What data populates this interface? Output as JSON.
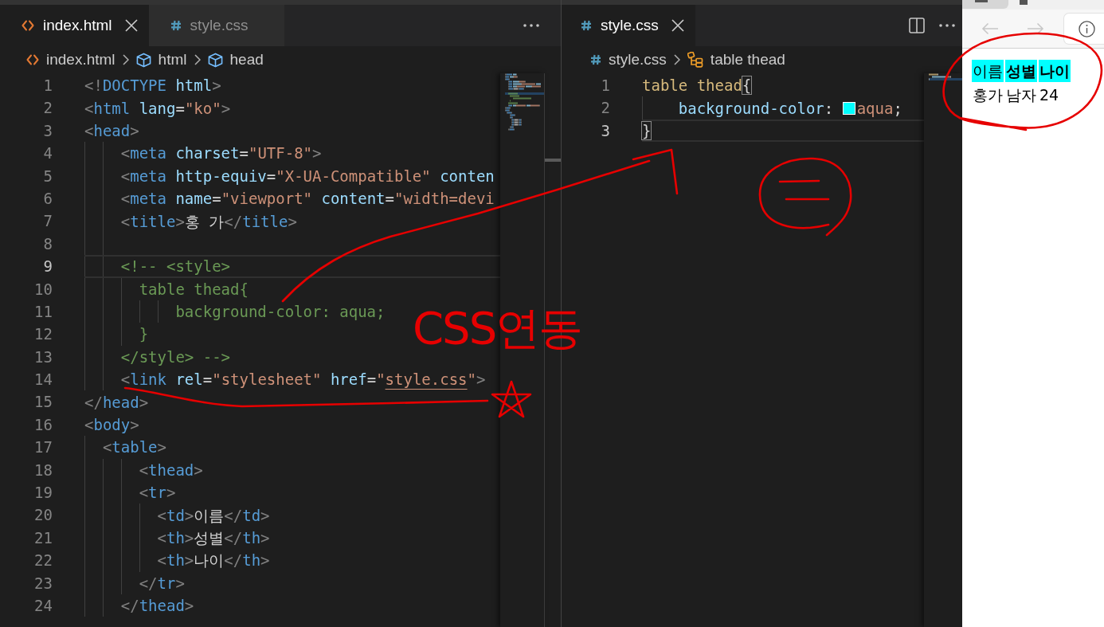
{
  "left_editor": {
    "tabs": [
      {
        "label": "index.html",
        "kind": "html",
        "selected": true
      },
      {
        "label": "style.css",
        "kind": "css",
        "selected": false
      }
    ],
    "breadcrumb": [
      {
        "label": "index.html",
        "kind": "html"
      },
      {
        "label": "html",
        "kind": "element"
      },
      {
        "label": "head",
        "kind": "element"
      }
    ],
    "lines": [
      {
        "number": "1",
        "current": false,
        "tokens": [
          {
            "kind": "punct",
            "text": "<!"
          },
          {
            "kind": "tag",
            "text": "DOCTYPE"
          },
          {
            "kind": "attr",
            "text": " html"
          },
          {
            "kind": "punct",
            "text": ">"
          }
        ]
      },
      {
        "number": "2",
        "current": false,
        "tokens": [
          {
            "kind": "punct",
            "text": "<"
          },
          {
            "kind": "tag",
            "text": "html"
          },
          {
            "kind": "attr",
            "text": " lang"
          },
          {
            "kind": "plain",
            "text": "="
          },
          {
            "kind": "string",
            "text": "\"ko\""
          },
          {
            "kind": "punct",
            "text": ">"
          }
        ]
      },
      {
        "number": "3",
        "current": false,
        "tokens": [
          {
            "kind": "punct",
            "text": "<"
          },
          {
            "kind": "tag",
            "text": "head"
          },
          {
            "kind": "punct",
            "text": ">"
          }
        ]
      },
      {
        "number": "4",
        "current": false,
        "tokens": [
          {
            "kind": "punct",
            "text": "    <"
          },
          {
            "kind": "tag",
            "text": "meta"
          },
          {
            "kind": "attr",
            "text": " charset"
          },
          {
            "kind": "plain",
            "text": "="
          },
          {
            "kind": "string",
            "text": "\"UTF-8\""
          },
          {
            "kind": "punct",
            "text": ">"
          }
        ]
      },
      {
        "number": "5",
        "current": false,
        "tokens": [
          {
            "kind": "punct",
            "text": "    <"
          },
          {
            "kind": "tag",
            "text": "meta"
          },
          {
            "kind": "attr",
            "text": " http-equiv"
          },
          {
            "kind": "plain",
            "text": "="
          },
          {
            "kind": "string",
            "text": "\"X-UA-Compatible\""
          },
          {
            "kind": "attr",
            "text": " conten"
          }
        ]
      },
      {
        "number": "6",
        "current": false,
        "tokens": [
          {
            "kind": "punct",
            "text": "    <"
          },
          {
            "kind": "tag",
            "text": "meta"
          },
          {
            "kind": "attr",
            "text": " name"
          },
          {
            "kind": "plain",
            "text": "="
          },
          {
            "kind": "string",
            "text": "\"viewport\""
          },
          {
            "kind": "attr",
            "text": " content"
          },
          {
            "kind": "plain",
            "text": "="
          },
          {
            "kind": "string",
            "text": "\"width=devi"
          }
        ]
      },
      {
        "number": "7",
        "current": false,
        "tokens": [
          {
            "kind": "punct",
            "text": "    <"
          },
          {
            "kind": "tag",
            "text": "title"
          },
          {
            "kind": "punct",
            "text": ">"
          },
          {
            "kind": "plain",
            "text": "홍 가"
          },
          {
            "kind": "punct",
            "text": "</"
          },
          {
            "kind": "tag",
            "text": "title"
          },
          {
            "kind": "punct",
            "text": ">"
          }
        ]
      },
      {
        "number": "8",
        "current": false
      },
      {
        "number": "9",
        "current": true,
        "tokens": [
          {
            "kind": "comment",
            "text": "    <!-- <style>"
          }
        ]
      },
      {
        "number": "10",
        "current": false,
        "tokens": [
          {
            "kind": "comment",
            "text": "      table thead{"
          }
        ]
      },
      {
        "number": "11",
        "current": false,
        "tokens": [
          {
            "kind": "comment",
            "text": "          background-color: aqua;"
          }
        ]
      },
      {
        "number": "12",
        "current": false,
        "tokens": [
          {
            "kind": "comment",
            "text": "      }"
          }
        ]
      },
      {
        "number": "13",
        "current": false,
        "tokens": [
          {
            "kind": "comment",
            "text": "    </style> -->"
          }
        ]
      },
      {
        "number": "14",
        "current": false,
        "tokens": [
          {
            "kind": "punct",
            "text": "    <"
          },
          {
            "kind": "tag",
            "text": "link"
          },
          {
            "kind": "attr",
            "text": " rel"
          },
          {
            "kind": "plain",
            "text": "="
          },
          {
            "kind": "string",
            "text": "\"stylesheet\""
          },
          {
            "kind": "attr",
            "text": " href"
          },
          {
            "kind": "plain",
            "text": "="
          },
          {
            "kind": "string",
            "text": "\""
          },
          {
            "kind": "link",
            "text": "style.css"
          },
          {
            "kind": "string",
            "text": "\""
          },
          {
            "kind": "punct",
            "text": ">"
          }
        ]
      },
      {
        "number": "15",
        "current": false,
        "tokens": [
          {
            "kind": "punct",
            "text": "</"
          },
          {
            "kind": "tag",
            "text": "head"
          },
          {
            "kind": "punct",
            "text": ">"
          }
        ]
      },
      {
        "number": "16",
        "current": false,
        "tokens": [
          {
            "kind": "punct",
            "text": "<"
          },
          {
            "kind": "tag",
            "text": "body"
          },
          {
            "kind": "punct",
            "text": ">"
          }
        ]
      },
      {
        "number": "17",
        "current": false,
        "tokens": [
          {
            "kind": "punct",
            "text": "  <"
          },
          {
            "kind": "tag",
            "text": "table"
          },
          {
            "kind": "punct",
            "text": ">"
          }
        ]
      },
      {
        "number": "18",
        "current": false,
        "tokens": [
          {
            "kind": "punct",
            "text": "      <"
          },
          {
            "kind": "tag",
            "text": "thead"
          },
          {
            "kind": "punct",
            "text": ">"
          }
        ]
      },
      {
        "number": "19",
        "current": false,
        "tokens": [
          {
            "kind": "punct",
            "text": "      <"
          },
          {
            "kind": "tag",
            "text": "tr"
          },
          {
            "kind": "punct",
            "text": ">"
          }
        ]
      },
      {
        "number": "20",
        "current": false,
        "tokens": [
          {
            "kind": "punct",
            "text": "        <"
          },
          {
            "kind": "tag",
            "text": "td"
          },
          {
            "kind": "punct",
            "text": ">"
          },
          {
            "kind": "plain",
            "text": "이름"
          },
          {
            "kind": "punct",
            "text": "</"
          },
          {
            "kind": "tag",
            "text": "td"
          },
          {
            "kind": "punct",
            "text": ">"
          }
        ]
      },
      {
        "number": "21",
        "current": false,
        "tokens": [
          {
            "kind": "punct",
            "text": "        <"
          },
          {
            "kind": "tag",
            "text": "th"
          },
          {
            "kind": "punct",
            "text": ">"
          },
          {
            "kind": "plain",
            "text": "성별"
          },
          {
            "kind": "punct",
            "text": "</"
          },
          {
            "kind": "tag",
            "text": "th"
          },
          {
            "kind": "punct",
            "text": ">"
          }
        ]
      },
      {
        "number": "22",
        "current": false,
        "tokens": [
          {
            "kind": "punct",
            "text": "        <"
          },
          {
            "kind": "tag",
            "text": "th"
          },
          {
            "kind": "punct",
            "text": ">"
          },
          {
            "kind": "plain",
            "text": "나이"
          },
          {
            "kind": "punct",
            "text": "</"
          },
          {
            "kind": "tag",
            "text": "th"
          },
          {
            "kind": "punct",
            "text": ">"
          }
        ]
      },
      {
        "number": "23",
        "current": false,
        "tokens": [
          {
            "kind": "punct",
            "text": "      </"
          },
          {
            "kind": "tag",
            "text": "tr"
          },
          {
            "kind": "punct",
            "text": ">"
          }
        ]
      },
      {
        "number": "24",
        "current": false,
        "tokens": [
          {
            "kind": "punct",
            "text": "    </"
          },
          {
            "kind": "tag",
            "text": "thead"
          },
          {
            "kind": "punct",
            "text": ">"
          }
        ]
      }
    ]
  },
  "right_editor": {
    "tabs": [
      {
        "label": "style.css",
        "kind": "css",
        "selected": true
      }
    ],
    "breadcrumb": [
      {
        "label": "style.css",
        "kind": "css"
      },
      {
        "label": "table thead",
        "kind": "rule"
      }
    ],
    "lines": [
      {
        "number": "1",
        "current": false,
        "tokens": [
          {
            "kind": "selector",
            "text": "table thead"
          },
          {
            "kind": "bracket",
            "text": "{",
            "matched": true
          }
        ]
      },
      {
        "number": "2",
        "current": false,
        "tokens": [
          {
            "kind": "property",
            "text": "    background-color"
          },
          {
            "kind": "plain",
            "text": ": "
          },
          {
            "kind": "swatch",
            "color": "#00ffff"
          },
          {
            "kind": "value",
            "text": "aqua"
          },
          {
            "kind": "plain",
            "text": ";"
          }
        ]
      },
      {
        "number": "3",
        "current": true,
        "tokens": [
          {
            "kind": "bracket",
            "text": "}",
            "matched": true
          }
        ]
      }
    ]
  },
  "browser": {
    "back": {
      "disabled": true
    },
    "forward": {
      "disabled": true
    },
    "table": {
      "head": [
        {
          "text": "이름",
          "kind": "td"
        },
        {
          "text": "성별",
          "kind": "th"
        },
        {
          "text": "나이",
          "kind": "th"
        }
      ],
      "rows": [
        [
          "홍가",
          "남자",
          "24"
        ]
      ]
    }
  },
  "annotations": {
    "note": "CSS연동"
  }
}
